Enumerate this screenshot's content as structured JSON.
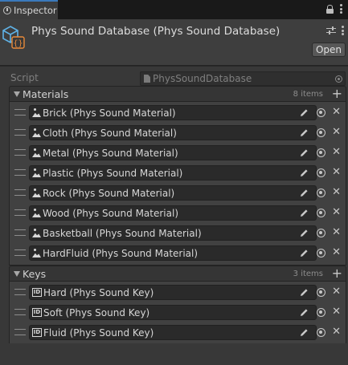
{
  "tab": {
    "label": "Inspector"
  },
  "header": {
    "title": "Phys Sound Database (Phys Sound Database)",
    "open_label": "Open"
  },
  "script": {
    "label": "Script",
    "value": "PhysSoundDatabase"
  },
  "materials": {
    "title": "Materials",
    "count": "8 items",
    "items": [
      "Brick (Phys Sound Material)",
      "Cloth (Phys Sound Material)",
      "Metal (Phys Sound Material)",
      "Plastic (Phys Sound Material)",
      "Rock (Phys Sound Material)",
      "Wood (Phys Sound Material)",
      "Basketball (Phys Sound Material)",
      "HardFluid (Phys Sound Material)"
    ]
  },
  "keys": {
    "title": "Keys",
    "count": "3 items",
    "items": [
      "Hard (Phys Sound Key)",
      "Soft (Phys Sound Key)",
      "Fluid (Phys Sound Key)"
    ]
  },
  "colors": {
    "accent": "#3a79bb",
    "panel": "#383838",
    "field": "#2a2a2a"
  }
}
